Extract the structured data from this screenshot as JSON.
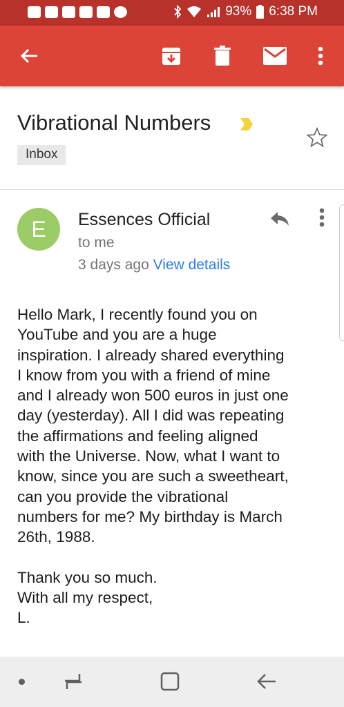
{
  "status_bar": {
    "battery": "93%",
    "time": "6:38 PM",
    "notification_icons": [
      "messages-icon",
      "gmail-icon",
      "facebook-icon",
      "facebook-icon",
      "chat-icon",
      "messenger-icon"
    ],
    "system_icons": [
      "bluetooth-icon",
      "wifi-icon",
      "signal-icon",
      "battery-icon"
    ],
    "color": "#b8312a"
  },
  "app_bar": {
    "color": "#db4437",
    "icons": [
      "back-arrow-icon",
      "archive-icon",
      "delete-icon",
      "mail-icon",
      "more-vert-icon"
    ]
  },
  "email": {
    "subject": "Vibrational Numbers",
    "label": "Inbox",
    "sender_initial": "E",
    "sender_name": "Essences Official",
    "recipient": "to me",
    "date": "3 days ago",
    "view_details": "View details",
    "avatar_color": "#9ccc65",
    "body": "Hello Mark, I recently found you on\nYouTube and you are a huge\ninspiration. I already shared everything\nI know from you with a friend of mine\nand I already won 500 euros in just one\nday (yesterday). All I did was repeating\nthe affirmations and feeling aligned\nwith the Universe. Now, what I want to\nknow, since you are such a sweetheart,\ncan you provide the vibrational\nnumbers for me? My birthday is March\n26th, 1988.\n\nThank you so much.\nWith all my respect,\nL."
  },
  "nav_bar": {
    "icons": [
      "nav-dot-icon",
      "recent-apps-icon",
      "home-icon",
      "back-icon"
    ]
  }
}
